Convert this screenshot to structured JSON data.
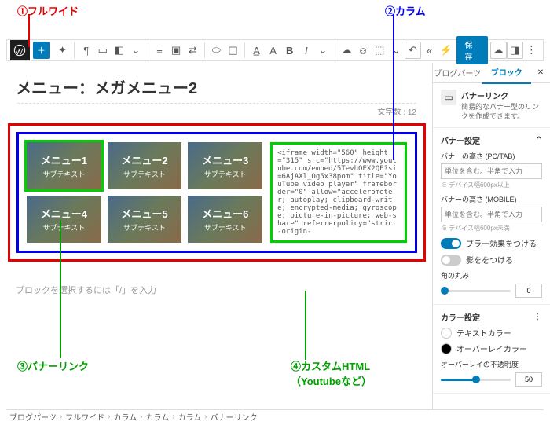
{
  "annotations": {
    "a1": "①フルワイド",
    "a2": "②カラム",
    "a3": "③バナーリンク",
    "a4": "④カスタムHTML\n（Youtubeなど）"
  },
  "toolbar": {
    "save": "保存"
  },
  "page": {
    "title": "メニュー：メガメニュー2",
    "char_count": "文字数 : 12",
    "placeholder_prompt": "ブロックを選択するには「/」を入力"
  },
  "banners": [
    {
      "title": "メニュー1",
      "sub": "サブテキスト",
      "selected": true
    },
    {
      "title": "メニュー2",
      "sub": "サブテキスト",
      "selected": false
    },
    {
      "title": "メニュー3",
      "sub": "サブテキスト",
      "selected": false
    },
    {
      "title": "メニュー4",
      "sub": "サブテキスト",
      "selected": false
    },
    {
      "title": "メニュー5",
      "sub": "サブテキスト",
      "selected": false
    },
    {
      "title": "メニュー6",
      "sub": "サブテキスト",
      "selected": false
    }
  ],
  "custom_html": "<iframe width=\"560\" height=\"315\" src=\"https://www.youtube.com/embed/5TevhOEX2QE?si=6AjAXl_Og5x38pom\" title=\"YouTube video player\" frameborder=\"0\" allow=\"accelerometer; autoplay; clipboard-write; encrypted-media; gyroscope; picture-in-picture; web-share\" referrerpolicy=\"strict-origin-",
  "breadcrumb": [
    "ブログパーツ",
    "フルワイド",
    "カラム",
    "カラム",
    "カラム",
    "バナーリンク"
  ],
  "sidebar": {
    "tab_parts": "ブログパーツ",
    "tab_block": "ブロック",
    "block": {
      "name": "バナーリンク",
      "desc": "簡易的なバナー型のリンクを作成できます。"
    },
    "panel_banner": "バナー設定",
    "height_pc_label": "バナーの高さ (PC/TAB)",
    "height_pc_ph": "単位を含む。半角で入力",
    "height_pc_hint": "※ デバイス幅600px以上",
    "height_mb_label": "バナーの高さ (MOBILE)",
    "height_mb_ph": "単位を含む。半角で入力",
    "height_mb_hint": "※ デバイス幅600px未満",
    "toggle_blur": "ブラー効果をつける",
    "toggle_shadow": "影ををつける",
    "radius_label": "角の丸み",
    "radius_val": "0",
    "panel_color": "カラー設定",
    "text_color": "テキストカラー",
    "overlay_color": "オーバーレイカラー",
    "overlay_opacity_label": "オーバーレイの不透明度",
    "overlay_opacity_val": "50"
  }
}
